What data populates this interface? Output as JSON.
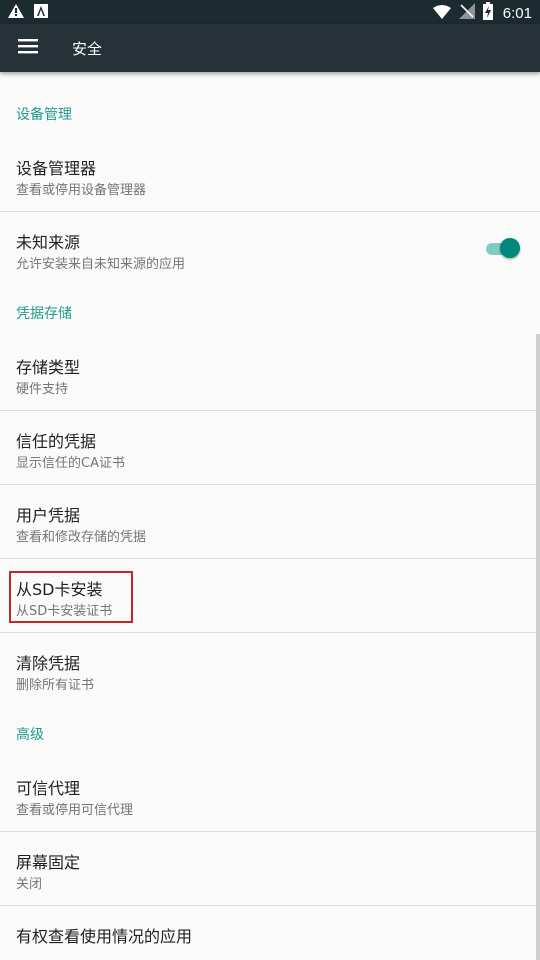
{
  "status_bar": {
    "time": "6:01",
    "left_icons": [
      "warning-icon",
      "notification-a-icon"
    ],
    "right_icons": [
      "wifi-icon",
      "no-signal-icon",
      "battery-charging-icon"
    ]
  },
  "app_bar": {
    "menu_icon": "hamburger-menu-icon",
    "title": "安全",
    "color": "#263238"
  },
  "accent_color": "#1e9b8a",
  "highlight_color": "#c0282c",
  "sections": {
    "device_admin": {
      "header": "设备管理",
      "items": {
        "device_administrators": {
          "title": "设备管理器",
          "summary": "查看或停用设备管理器"
        },
        "unknown_sources": {
          "title": "未知来源",
          "summary": "允许安装来自未知来源的应用",
          "toggle_on": true
        }
      }
    },
    "credential_storage": {
      "header": "凭据存储",
      "items": {
        "storage_type": {
          "title": "存储类型",
          "summary": "硬件支持"
        },
        "trusted_credentials": {
          "title": "信任的凭据",
          "summary": "显示信任的CA证书"
        },
        "user_credentials": {
          "title": "用户凭据",
          "summary": "查看和修改存储的凭据"
        },
        "install_from_sd": {
          "title": "从SD卡安装",
          "summary": "从SD卡安装证书",
          "highlighted": true
        },
        "clear_credentials": {
          "title": "清除凭据",
          "summary": "删除所有证书"
        }
      }
    },
    "advanced": {
      "header": "高级",
      "items": {
        "trust_agents": {
          "title": "可信代理",
          "summary": "查看或停用可信代理"
        },
        "screen_pinning": {
          "title": "屏幕固定",
          "summary": "关闭"
        },
        "usage_access": {
          "title": "有权查看使用情况的应用"
        }
      }
    }
  }
}
